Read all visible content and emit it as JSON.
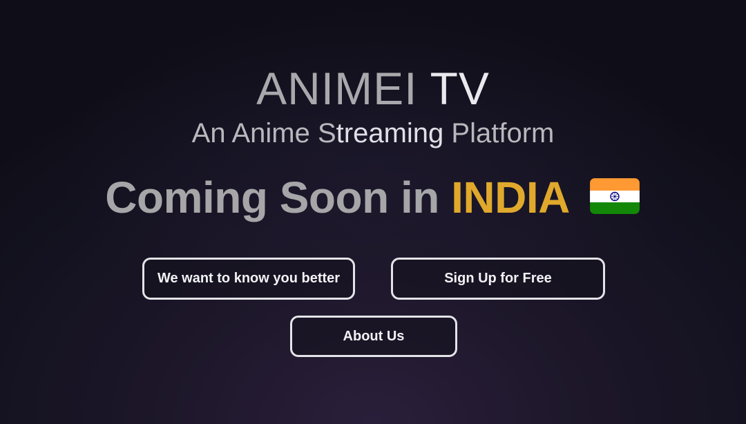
{
  "brand": {
    "part1": "ANIMEI",
    "part2": "TV"
  },
  "tagline": {
    "before": "An Anime S",
    "highlight": "treaming",
    "after": " Platform"
  },
  "headline": {
    "text": "Coming Soon in",
    "country": "INDIA",
    "flag": "india-flag-icon"
  },
  "buttons": {
    "know_better": "We want to know you better",
    "sign_up": "Sign Up for Free",
    "about_us": "About Us"
  },
  "colors": {
    "background": "#141220",
    "accent_gold": "#e0a92c",
    "headline_grey": "#a6a6a8",
    "button_border": "#e4e4e8"
  }
}
